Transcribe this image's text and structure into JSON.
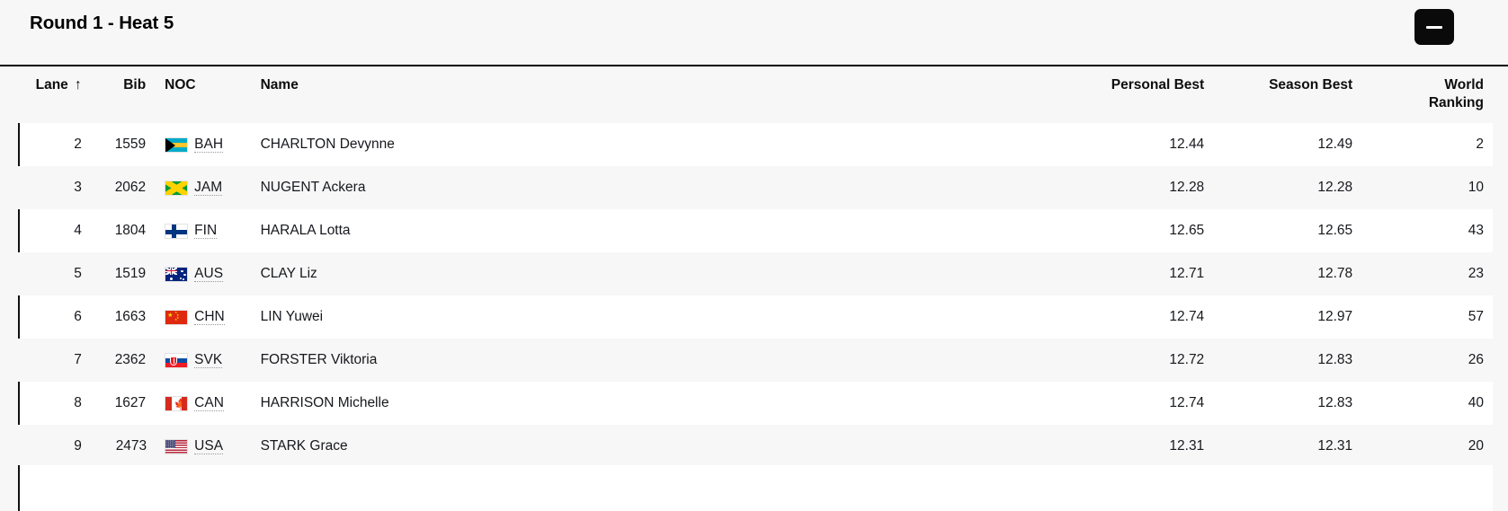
{
  "header": {
    "title": "Round 1 - Heat 5",
    "collapse_button_label": "−",
    "collapse_icon": "minus-icon"
  },
  "table": {
    "columns": [
      {
        "key": "lane",
        "label": "Lane",
        "sort": "ascending",
        "sort_glyph": "↑"
      },
      {
        "key": "bib",
        "label": "Bib"
      },
      {
        "key": "noc",
        "label": "NOC"
      },
      {
        "key": "name",
        "label": "Name"
      },
      {
        "key": "personal_best",
        "label": "Personal Best"
      },
      {
        "key": "season_best",
        "label": "Season Best"
      },
      {
        "key": "world_ranking",
        "label_line1": "World",
        "label_line2": "Ranking"
      }
    ],
    "rows": [
      {
        "lane": "2",
        "bib": "1559",
        "noc": "BAH",
        "flag": "flag-bahamas",
        "name": "CHARLTON Devynne",
        "personal_best": "12.44",
        "season_best": "12.49",
        "world_ranking": "2"
      },
      {
        "lane": "3",
        "bib": "2062",
        "noc": "JAM",
        "flag": "flag-jamaica",
        "name": "NUGENT Ackera",
        "personal_best": "12.28",
        "season_best": "12.28",
        "world_ranking": "10"
      },
      {
        "lane": "4",
        "bib": "1804",
        "noc": "FIN",
        "flag": "flag-finland",
        "name": "HARALA Lotta",
        "personal_best": "12.65",
        "season_best": "12.65",
        "world_ranking": "43"
      },
      {
        "lane": "5",
        "bib": "1519",
        "noc": "AUS",
        "flag": "flag-australia",
        "name": "CLAY Liz",
        "personal_best": "12.71",
        "season_best": "12.78",
        "world_ranking": "23"
      },
      {
        "lane": "6",
        "bib": "1663",
        "noc": "CHN",
        "flag": "flag-china",
        "name": "LIN Yuwei",
        "personal_best": "12.74",
        "season_best": "12.97",
        "world_ranking": "57"
      },
      {
        "lane": "7",
        "bib": "2362",
        "noc": "SVK",
        "flag": "flag-slovakia",
        "name": "FORSTER Viktoria",
        "personal_best": "12.72",
        "season_best": "12.83",
        "world_ranking": "26"
      },
      {
        "lane": "8",
        "bib": "1627",
        "noc": "CAN",
        "flag": "flag-canada",
        "name": "HARRISON Michelle",
        "personal_best": "12.74",
        "season_best": "12.83",
        "world_ranking": "40"
      },
      {
        "lane": "9",
        "bib": "2473",
        "noc": "USA",
        "flag": "flag-usa",
        "name": "STARK Grace",
        "personal_best": "12.31",
        "season_best": "12.31",
        "world_ranking": "20"
      }
    ]
  },
  "colors": {
    "page_background": "#f7f7f7",
    "row_white": "#ffffff",
    "row_alt": "#f7f7f7",
    "text": "#16181d",
    "divider": "#000000",
    "button_background": "#0a0a0a"
  }
}
